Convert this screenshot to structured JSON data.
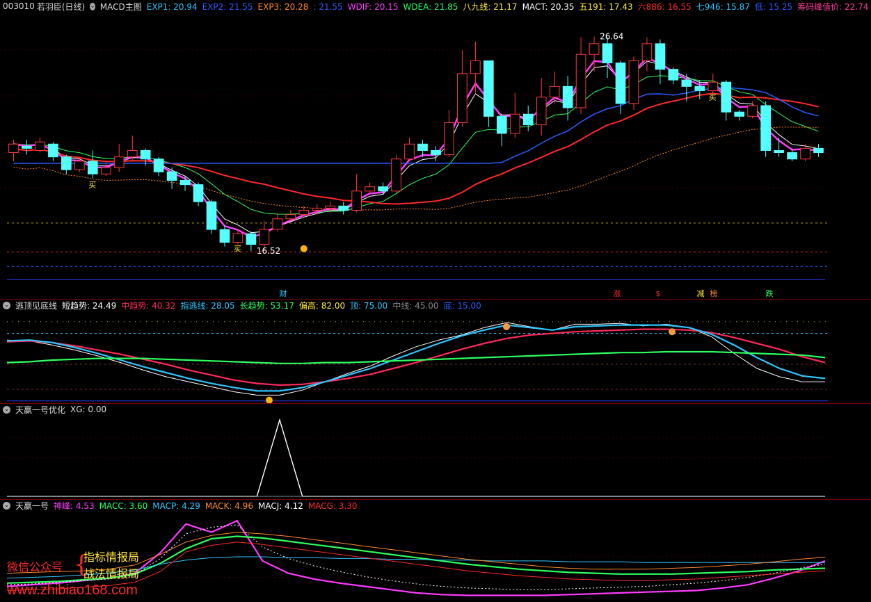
{
  "main": {
    "code": "003010",
    "name": "若羽臣",
    "period": "(日线)",
    "indicator": "MACD主图",
    "readouts": [
      {
        "label": "EXP1: 20.94",
        "color": "#2fc5ff"
      },
      {
        "label": "EXP2: 21.55",
        "color": "#2a5cff"
      },
      {
        "label": "EXP3: 20.28",
        "color": "#ff8a2a"
      },
      {
        "label": ": 21.55",
        "color": "#2a5cff"
      },
      {
        "label": "WDIF: 20.15",
        "color": "#ff3cff"
      },
      {
        "label": "WDEA: 21.85",
        "color": "#2dff5e"
      },
      {
        "label": "八九线: 21.17",
        "color": "#ffe93a"
      },
      {
        "label": "MACT: 20.35",
        "color": "#ffffff"
      },
      {
        "label": "五191: 17.43",
        "color": "#ffe93a"
      },
      {
        "label": "六886: 16.55",
        "color": "#ff2a2a"
      },
      {
        "label": "七946: 15.87",
        "color": "#2fc5ff"
      },
      {
        "label": "低: 15.25",
        "color": "#2a5cff"
      },
      {
        "label": "筹码峰值价: 22.74",
        "color": "#ff3c9c"
      }
    ],
    "high_label": "26.64",
    "low_label": "16.52",
    "buy_labels": [
      "买",
      "买",
      "买"
    ],
    "event_labels": [
      {
        "text": "财",
        "color": "#2fc5ff"
      },
      {
        "text": "涨",
        "color": "#ff2a2a"
      },
      {
        "text": "$",
        "color": "#ff2a2a"
      },
      {
        "text": "减",
        "color": "#ffe93a"
      },
      {
        "text": "榜",
        "color": "#ff8a2a"
      },
      {
        "text": "跌",
        "color": "#2dff5e"
      }
    ]
  },
  "panel2": {
    "title": "逃顶见底线",
    "readouts": [
      {
        "label": "短趋势: 24.49",
        "color": "#ffffff"
      },
      {
        "label": "中趋势: 40.32",
        "color": "#ff2a5a"
      },
      {
        "label": "指逃线: 28.05",
        "color": "#2fc5ff"
      },
      {
        "label": "长趋势: 53.17",
        "color": "#2dff5e"
      },
      {
        "label": "偏高: 82.00",
        "color": "#ffe93a"
      },
      {
        "label": "顶: 75.00",
        "color": "#2fc5ff"
      },
      {
        "label": "中线: 45.00",
        "color": "#888888"
      },
      {
        "label": "底: 15.00",
        "color": "#2a5cff"
      }
    ]
  },
  "panel3": {
    "title": "天赢一号优化",
    "readouts": [
      {
        "label": "XG: 0.00",
        "color": "#dddddd"
      }
    ]
  },
  "panel4": {
    "title": "天赢一号",
    "readouts": [
      {
        "label": "神峰: 4.53",
        "color": "#ff3cff"
      },
      {
        "label": "MACC: 3.60",
        "color": "#2dff5e"
      },
      {
        "label": "MACP: 4.29",
        "color": "#2fc5ff"
      },
      {
        "label": "MACK: 4.96",
        "color": "#ff8a2a"
      },
      {
        "label": "MACJ: 4.12",
        "color": "#ffffff"
      },
      {
        "label": "MACG: 3.30",
        "color": "#ff2a2a"
      }
    ]
  },
  "watermark": {
    "left": "微信公众号",
    "right1": "指标情报局",
    "right2": "战法情报局",
    "site": "www.zhibiao168.com"
  },
  "chart_data": [
    {
      "type": "candlestick",
      "title": "003010 若羽臣 (日线) MACD主图",
      "ylim": [
        15.0,
        27.5
      ],
      "candles": [
        [
          21.2,
          21.6,
          20.8,
          21.8
        ],
        [
          21.5,
          21.4,
          21.1,
          21.8
        ],
        [
          21.3,
          21.7,
          21.2,
          21.9
        ],
        [
          21.6,
          21.0,
          20.8,
          21.7
        ],
        [
          21.0,
          20.4,
          20.2,
          21.1
        ],
        [
          20.4,
          20.8,
          20.3,
          20.9
        ],
        [
          20.8,
          20.2,
          20.0,
          21.3
        ],
        [
          20.2,
          20.5,
          20.1,
          20.7
        ],
        [
          20.5,
          21.0,
          20.3,
          21.6
        ],
        [
          21.0,
          21.3,
          20.8,
          22.0
        ],
        [
          21.3,
          20.9,
          20.6,
          21.4
        ],
        [
          20.9,
          20.3,
          20.1,
          21.0
        ],
        [
          20.3,
          19.9,
          19.5,
          20.5
        ],
        [
          19.9,
          19.7,
          19.4,
          20.1
        ],
        [
          19.7,
          18.9,
          18.7,
          19.8
        ],
        [
          18.9,
          17.6,
          17.4,
          19.0
        ],
        [
          17.6,
          17.0,
          16.8,
          17.8
        ],
        [
          17.0,
          17.4,
          16.9,
          17.6
        ],
        [
          17.4,
          16.9,
          16.6,
          17.5
        ],
        [
          16.9,
          17.6,
          16.6,
          18.0
        ],
        [
          17.6,
          18.1,
          17.5,
          18.3
        ],
        [
          18.1,
          18.3,
          18.0,
          18.5
        ],
        [
          18.3,
          18.5,
          18.2,
          18.7
        ],
        [
          18.5,
          18.6,
          18.3,
          18.8
        ],
        [
          18.6,
          18.7,
          18.4,
          18.9
        ],
        [
          18.7,
          18.5,
          18.3,
          18.9
        ],
        [
          18.5,
          19.4,
          18.4,
          20.2
        ],
        [
          19.4,
          19.6,
          19.3,
          19.8
        ],
        [
          19.6,
          19.4,
          19.2,
          19.8
        ],
        [
          19.4,
          20.9,
          19.3,
          21.1
        ],
        [
          20.9,
          21.6,
          20.8,
          21.9
        ],
        [
          21.6,
          21.3,
          21.0,
          21.8
        ],
        [
          21.3,
          21.1,
          20.8,
          21.5
        ],
        [
          21.1,
          22.6,
          21.0,
          23.2
        ],
        [
          22.6,
          24.9,
          22.4,
          26.0
        ],
        [
          24.9,
          25.5,
          24.0,
          26.4
        ],
        [
          25.5,
          22.9,
          22.4,
          25.0
        ],
        [
          22.9,
          22.1,
          21.5,
          23.0
        ],
        [
          22.1,
          23.0,
          21.9,
          24.0
        ],
        [
          23.0,
          22.5,
          22.2,
          23.4
        ],
        [
          22.5,
          23.8,
          22.0,
          24.7
        ],
        [
          23.8,
          24.3,
          23.5,
          25.0
        ],
        [
          24.3,
          23.3,
          22.7,
          24.8
        ],
        [
          23.3,
          25.8,
          23.0,
          26.6
        ],
        [
          25.8,
          26.3,
          25.0,
          26.64
        ],
        [
          26.3,
          25.4,
          24.7,
          26.6
        ],
        [
          25.4,
          23.5,
          23.0,
          25.5
        ],
        [
          23.5,
          25.5,
          23.2,
          25.7
        ],
        [
          25.5,
          26.3,
          25.0,
          26.6
        ],
        [
          26.3,
          25.1,
          24.4,
          26.5
        ],
        [
          25.1,
          24.6,
          24.4,
          25.2
        ],
        [
          24.6,
          24.3,
          23.6,
          24.9
        ],
        [
          24.3,
          24.1,
          23.7,
          24.6
        ],
        [
          24.1,
          24.5,
          23.9,
          24.9
        ],
        [
          24.5,
          23.1,
          22.7,
          24.6
        ],
        [
          23.1,
          22.9,
          22.7,
          23.2
        ],
        [
          22.9,
          23.4,
          22.8,
          23.6
        ],
        [
          23.4,
          21.3,
          21.0,
          23.6
        ],
        [
          21.3,
          21.2,
          21.0,
          21.9
        ],
        [
          21.2,
          20.9,
          20.8,
          21.4
        ],
        [
          20.9,
          21.4,
          20.8,
          21.6
        ],
        [
          21.4,
          21.2,
          21.0,
          21.6
        ]
      ]
    },
    {
      "type": "line",
      "title": "逃顶见底线",
      "ylim": [
        0,
        100
      ],
      "reference_lines": [
        82,
        75,
        45,
        15
      ],
      "series": [
        {
          "name": "短趋势",
          "values": [
            74,
            73,
            68,
            62,
            55,
            47,
            38,
            30,
            24,
            18,
            12,
            8,
            8,
            14,
            24,
            34,
            43,
            55,
            66,
            74,
            80,
            89,
            95,
            90,
            86,
            93,
            93,
            94,
            91,
            93,
            89,
            78,
            58,
            40,
            30,
            24,
            24
          ]
        },
        {
          "name": "中趋势",
          "values": [
            72,
            73,
            71,
            67,
            62,
            57,
            51,
            45,
            38,
            32,
            26,
            22,
            20,
            21,
            24,
            28,
            33,
            40,
            47,
            55,
            63,
            70,
            76,
            80,
            82,
            84,
            85,
            86,
            87,
            87,
            86,
            83,
            77,
            70,
            63,
            54,
            47
          ]
        },
        {
          "name": "指逃线",
          "values": [
            73,
            74,
            71,
            65,
            58,
            50,
            42,
            35,
            28,
            22,
            17,
            13,
            13,
            17,
            24,
            32,
            40,
            50,
            60,
            70,
            79,
            86,
            92,
            89,
            86,
            90,
            91,
            92,
            92,
            92,
            89,
            81,
            68,
            53,
            40,
            31,
            28
          ]
        },
        {
          "name": "长趋势",
          "values": [
            47,
            48,
            50,
            51,
            52,
            52,
            52,
            51,
            50,
            49,
            48,
            47,
            46,
            46,
            47,
            47,
            48,
            49,
            50,
            51,
            52,
            53,
            54,
            55,
            56,
            57,
            58,
            59,
            59,
            60,
            60,
            60,
            59,
            58,
            57,
            56,
            53
          ]
        }
      ]
    },
    {
      "type": "line",
      "title": "天赢一号优化",
      "ylim": [
        0,
        1
      ],
      "series": [
        {
          "name": "XG",
          "values": [
            0,
            0,
            0,
            0,
            0,
            0,
            0,
            0,
            0,
            0,
            0,
            0,
            1,
            0,
            0,
            0,
            0,
            0,
            0,
            0,
            0,
            0,
            0,
            0,
            0,
            0,
            0,
            0,
            0,
            0,
            0,
            0,
            0,
            0,
            0,
            0,
            0
          ]
        }
      ]
    },
    {
      "type": "line",
      "title": "天赢一号",
      "ylim": [
        0,
        10
      ],
      "series": [
        {
          "name": "神峰",
          "values": [
            1.4,
            1.6,
            1.8,
            2.1,
            2.4,
            3.0,
            5.5,
            9.0,
            8.0,
            9.4,
            4.5,
            3.0,
            2.3,
            1.8,
            1.4,
            1.0,
            0.6,
            0.4,
            0.3,
            0.3,
            0.3,
            0.3,
            0.4,
            0.5,
            0.6,
            0.7,
            0.8,
            0.9,
            1.2,
            1.6,
            2.4,
            3.3,
            4.5
          ]
        },
        {
          "name": "MACC",
          "values": [
            1.8,
            1.9,
            2.0,
            2.2,
            2.4,
            2.9,
            4.2,
            6.0,
            7.2,
            7.5,
            7.3,
            6.9,
            6.5,
            6.1,
            5.7,
            5.3,
            4.9,
            4.5,
            4.1,
            3.8,
            3.5,
            3.3,
            3.1,
            3.0,
            2.9,
            2.9,
            2.9,
            3.0,
            3.1,
            3.2,
            3.4,
            3.5,
            3.6
          ]
        },
        {
          "name": "MACP",
          "values": [
            2.4,
            2.5,
            2.6,
            2.8,
            3.0,
            3.4,
            4.1,
            4.6,
            4.9,
            5.0,
            5.0,
            4.9,
            4.9,
            4.8,
            4.8,
            4.7,
            4.7,
            4.6,
            4.6,
            4.5,
            4.5,
            4.5,
            4.4,
            4.4,
            4.4,
            4.3,
            4.3,
            4.3,
            4.3,
            4.3,
            4.3,
            4.3,
            4.29
          ]
        },
        {
          "name": "MACK",
          "values": [
            3.0,
            3.1,
            3.2,
            3.3,
            3.5,
            4.0,
            5.3,
            6.8,
            7.6,
            8.0,
            7.8,
            7.5,
            7.1,
            6.7,
            6.3,
            5.9,
            5.5,
            5.1,
            4.7,
            4.4,
            4.1,
            3.8,
            3.6,
            3.5,
            3.5,
            3.5,
            3.6,
            3.7,
            3.9,
            4.1,
            4.4,
            4.7,
            4.96
          ]
        },
        {
          "name": "MACJ",
          "values": [
            1.6,
            1.7,
            1.9,
            2.1,
            2.3,
            2.8,
            4.8,
            7.8,
            8.6,
            8.9,
            6.2,
            4.8,
            3.9,
            3.2,
            2.6,
            2.1,
            1.7,
            1.4,
            1.2,
            1.1,
            1.0,
            1.0,
            1.1,
            1.2,
            1.3,
            1.4,
            1.6,
            1.8,
            2.1,
            2.5,
            3.0,
            3.6,
            4.12
          ]
        },
        {
          "name": "MACG",
          "values": [
            0.9,
            1.0,
            1.1,
            1.3,
            1.5,
            1.9,
            3.2,
            5.6,
            6.4,
            6.8,
            6.5,
            6.1,
            5.7,
            5.3,
            4.9,
            4.5,
            4.1,
            3.7,
            3.3,
            3.0,
            2.7,
            2.5,
            2.3,
            2.2,
            2.1,
            2.1,
            2.2,
            2.3,
            2.5,
            2.7,
            2.9,
            3.1,
            3.3
          ]
        }
      ]
    }
  ]
}
